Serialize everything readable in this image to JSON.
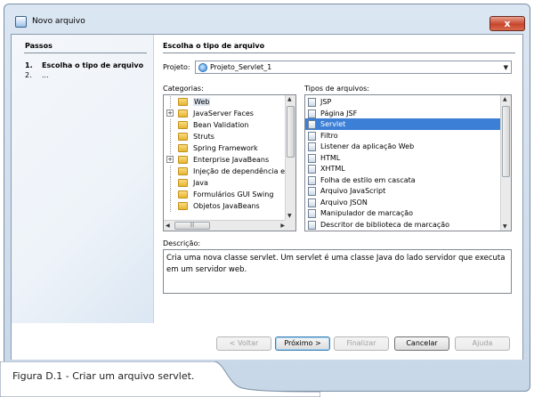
{
  "window": {
    "title": "Novo arquivo",
    "close_symbol": "x"
  },
  "steps": {
    "heading": "Passos",
    "items": [
      {
        "num": "1.",
        "label": "Escolha o tipo de arquivo"
      },
      {
        "num": "2.",
        "label": "..."
      }
    ]
  },
  "main": {
    "heading": "Escolha o tipo de arquivo",
    "project_label": "Projeto:",
    "project_value": "Projeto_Servlet_1",
    "categories_label": "Categorias:",
    "file_types_label": "Tipos de arquivos:",
    "categories": [
      {
        "label": "Web",
        "expandable": false,
        "selected": true
      },
      {
        "label": "JavaServer Faces",
        "expandable": true,
        "selected": false
      },
      {
        "label": "Bean Validation",
        "expandable": false,
        "selected": false
      },
      {
        "label": "Struts",
        "expandable": false,
        "selected": false
      },
      {
        "label": "Spring Framework",
        "expandable": false,
        "selected": false
      },
      {
        "label": "Enterprise JavaBeans",
        "expandable": true,
        "selected": false
      },
      {
        "label": "Injeção de dependência e c",
        "expandable": false,
        "selected": false
      },
      {
        "label": "Java",
        "expandable": false,
        "selected": false
      },
      {
        "label": "Formulários GUI Swing",
        "expandable": false,
        "selected": false
      },
      {
        "label": "Objetos JavaBeans",
        "expandable": false,
        "selected": false
      }
    ],
    "file_types": [
      {
        "label": "JSP",
        "selected": false
      },
      {
        "label": "Página JSF",
        "selected": false
      },
      {
        "label": "Servlet",
        "selected": true
      },
      {
        "label": "Filtro",
        "selected": false
      },
      {
        "label": "Listener da aplicação Web",
        "selected": false
      },
      {
        "label": "HTML",
        "selected": false
      },
      {
        "label": "XHTML",
        "selected": false
      },
      {
        "label": "Folha de estilo em cascata",
        "selected": false
      },
      {
        "label": "Arquivo JavaScript",
        "selected": false
      },
      {
        "label": "Arquivo JSON",
        "selected": false
      },
      {
        "label": "Manipulador de marcação",
        "selected": false
      },
      {
        "label": "Descritor de biblioteca de marcação",
        "selected": false
      }
    ],
    "description_label": "Descrição:",
    "description_text": "Cria uma nova classe servlet. Um servlet é uma classe Java do lado servidor que executa em um servidor web."
  },
  "buttons": {
    "back": "< Voltar",
    "next": "Próximo >",
    "finish": "Finalizar",
    "cancel": "Cancelar",
    "help": "Ajuda"
  },
  "caption": "Figura D.1 - Criar um arquivo servlet."
}
